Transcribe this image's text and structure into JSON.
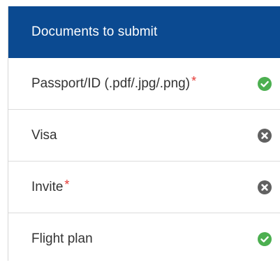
{
  "header": {
    "title": "Documents to submit"
  },
  "documents": [
    {
      "label": "Passport/ID (.pdf/.jpg/.png)",
      "required": true,
      "required_mark": "*",
      "status": "check-icon"
    },
    {
      "label": "Visa",
      "required": false,
      "required_mark": "",
      "status": "x-icon"
    },
    {
      "label": "Invite",
      "required": true,
      "required_mark": "*",
      "status": "x-icon"
    },
    {
      "label": "Flight plan",
      "required": false,
      "required_mark": "",
      "status": "check-icon"
    }
  ],
  "colors": {
    "header_bg": "#0b4a91",
    "check": "#4caf50",
    "x": "#616161",
    "required": "#e53935"
  }
}
